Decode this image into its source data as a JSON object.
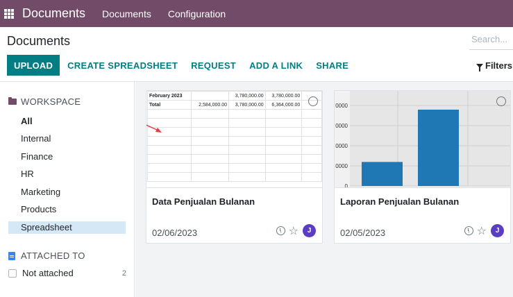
{
  "navbar": {
    "brand": "Documents",
    "menu": [
      "Documents",
      "Configuration"
    ]
  },
  "control": {
    "title": "Documents",
    "search_placeholder": "Search...",
    "upload_label": "UPLOAD",
    "actions": [
      "CREATE SPREADSHEET",
      "REQUEST",
      "ADD A LINK",
      "SHARE"
    ],
    "filters_label": "Filters"
  },
  "sidebar": {
    "workspace_heading": "WORKSPACE",
    "items": [
      "All",
      "Internal",
      "Finance",
      "HR",
      "Marketing",
      "Products",
      "Spreadsheet"
    ],
    "active_item": "All",
    "selected_item": "Spreadsheet",
    "attached_heading": "ATTACHED TO",
    "not_attached_label": "Not attached",
    "not_attached_count": "2"
  },
  "documents": [
    {
      "name": "Data Penjualan Bulanan",
      "date": "02/06/2023",
      "avatar": "J",
      "thumbnail": {
        "type": "spreadsheet",
        "rows": [
          [
            "February 2023",
            "",
            "3,780,000.00",
            "3,780,000.00"
          ],
          [
            "Total",
            "2,584,000.00",
            "3,780,000.00",
            "6,364,000.00"
          ]
        ]
      }
    },
    {
      "name": "Laporan Penjualan Bulanan",
      "date": "02/05/2023",
      "avatar": "J",
      "thumbnail": {
        "type": "chart"
      }
    }
  ],
  "chart_data": {
    "type": "bar",
    "ytick_labels": [
      "0",
      "0000",
      "0000",
      "0000",
      "0000"
    ],
    "bar_color": "#1f77b4",
    "values": [
      0.286,
      0.909
    ],
    "grid": true
  },
  "colors": {
    "navbar": "#714b67",
    "primary": "#017e84",
    "avatar": "#5b3cc4",
    "selected": "#d4e8f6"
  }
}
